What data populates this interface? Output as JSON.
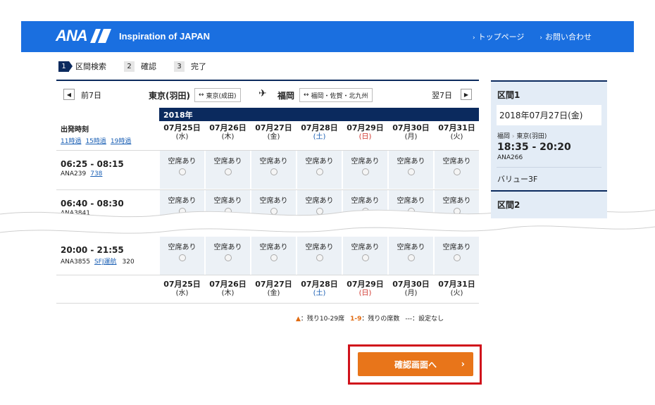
{
  "header": {
    "logo": "ANA",
    "title": "Inspiration of JAPAN",
    "links": [
      "トップページ",
      "お問い合わせ"
    ]
  },
  "steps": [
    {
      "num": "1",
      "label": "区間検索"
    },
    {
      "num": "2",
      "label": "確認"
    },
    {
      "num": "3",
      "label": "完了"
    }
  ],
  "route": {
    "prev": "前7日",
    "next": "翌7日",
    "from": "東京(羽田)",
    "from_alt": "東京(成田)",
    "to": "福岡",
    "to_alt": "福岡・佐賀・北九州"
  },
  "grid": {
    "year": "2018年",
    "time_label": "出発時刻",
    "time_links": [
      "11時過",
      "15時過",
      "19時過"
    ],
    "dates": [
      {
        "date": "07月25日",
        "dow": "(水)",
        "kind": "weekday"
      },
      {
        "date": "07月26日",
        "dow": "(木)",
        "kind": "weekday"
      },
      {
        "date": "07月27日",
        "dow": "(金)",
        "kind": "weekday"
      },
      {
        "date": "07月28日",
        "dow": "(土)",
        "kind": "sat"
      },
      {
        "date": "07月29日",
        "dow": "(日)",
        "kind": "sun"
      },
      {
        "date": "07月30日",
        "dow": "(月)",
        "kind": "weekday"
      },
      {
        "date": "07月31日",
        "dow": "(火)",
        "kind": "weekday"
      }
    ],
    "seat_text": "空席あり",
    "flights": [
      {
        "time": "06:25 - 08:15",
        "no": "ANA239",
        "extra": "738"
      },
      {
        "time": "06:40 - 08:30",
        "no": "ANA3841",
        "extra": ""
      },
      {
        "time": "20:00 - 21:55",
        "no": "ANA3855",
        "extra": "SFJ運航",
        "aircraft": "320"
      }
    ]
  },
  "legend": {
    "tri": "▲",
    "tri_text": "：残り10-29席",
    "num": "1-9",
    "num_text": "：残りの席数",
    "dash_text": "---：設定なし"
  },
  "confirm_button": "確認画面へ",
  "side": {
    "section1": "区間1",
    "date": "2018年07月27日(金)",
    "route_from": "福岡",
    "route_to": "東京(羽田)",
    "time": "18:35 - 20:20",
    "flight": "ANA266",
    "fare": "バリュー3F",
    "section2": "区間2"
  }
}
